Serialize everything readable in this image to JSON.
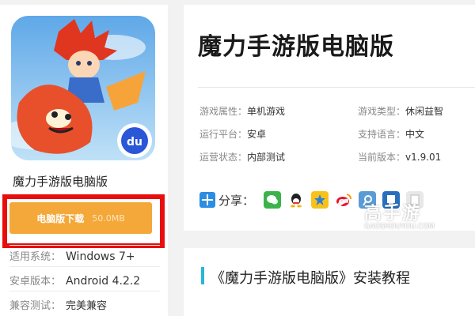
{
  "app": {
    "name": "魔力手游版电脑版",
    "title": "魔力手游版电脑版"
  },
  "download": {
    "label": "电脑版下载",
    "size": "50.0MB"
  },
  "specs": [
    {
      "key": "适用系统：",
      "value": "Windows 7+"
    },
    {
      "key": "安卓版本：",
      "value": "Android 4.2.2"
    },
    {
      "key": "兼容测试：",
      "value": "完美兼容"
    }
  ],
  "attributes": {
    "game_attr": {
      "key": "游戏属性：",
      "value": "单机游戏"
    },
    "game_type": {
      "key": "游戏类型：",
      "value": "休闲益智"
    },
    "platform": {
      "key": "运行平台：",
      "value": "安卓"
    },
    "language": {
      "key": "支持语言：",
      "value": "中文"
    },
    "status": {
      "key": "运营状态：",
      "value": "内部测试"
    },
    "version": {
      "key": "当前版本：",
      "value": "v1.9.01"
    }
  },
  "share": {
    "label": "分享：",
    "icons": [
      "wechat-icon",
      "qq-icon",
      "qzone-icon",
      "weibo-icon",
      "qq-weibo-icon",
      "renren-icon",
      "more-share-icon"
    ]
  },
  "watermark": {
    "main": "高手游",
    "sub": "GAOSHOUYOU.COM"
  },
  "section": {
    "title": "《魔力手游版电脑版》安装教程"
  },
  "colors": {
    "download_bg": "#f4a83a",
    "highlight_frame": "#e80e0e",
    "section_accent": "#29b6d9",
    "share_blue": "#2c8de2"
  }
}
